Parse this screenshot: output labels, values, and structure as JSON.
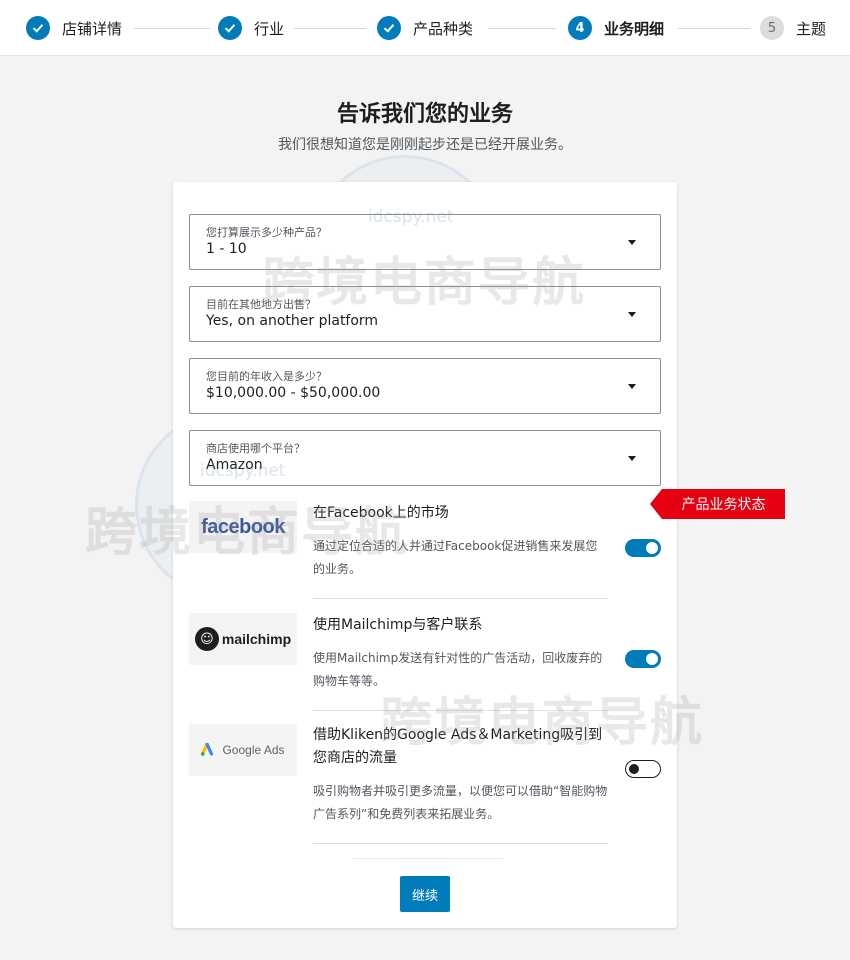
{
  "stepper": {
    "steps": [
      {
        "label": "店铺详情",
        "state": "done",
        "icon": "check-icon"
      },
      {
        "label": "行业",
        "state": "done",
        "icon": "check-icon"
      },
      {
        "label": "产品种类",
        "state": "done",
        "icon": "check-icon"
      },
      {
        "label": "业务明细",
        "state": "active",
        "number": "4"
      },
      {
        "label": "主题",
        "state": "todo",
        "number": "5"
      }
    ]
  },
  "page": {
    "title": "告诉我们您的业务",
    "subtitle": "我们很想知道您是刚刚起步还是已经开展业务。"
  },
  "form": {
    "fields": [
      {
        "label": "您打算展示多少种产品？",
        "value": "1 - 10"
      },
      {
        "label": "目前在其他地方出售？",
        "value": "Yes, on another platform"
      },
      {
        "label": "您目前的年收入是多少？",
        "value": "$10,000.00 - $50,000.00"
      },
      {
        "label": "商店使用哪个平台？",
        "value": "Amazon"
      }
    ],
    "extensions": [
      {
        "logo_text": "facebook",
        "title": "在Facebook上的市场",
        "desc": "通过定位合适的人并通过Facebook促进销售来发展您的业务。",
        "enabled": true
      },
      {
        "logo_text": "mailchimp",
        "title": "使用Mailchimp与客户联系",
        "desc": "使用Mailchimp发送有针对性的广告活动，回收废弃的购物车等等。",
        "enabled": true
      },
      {
        "logo_text": "Google Ads",
        "title": "借助Kliken的Google Ads＆Marketing吸引到您商店的流量",
        "desc": "吸引购物者并吸引更多流量，以便您可以借助“智能购物广告系列”和免费列表来拓展业务。",
        "enabled": false
      }
    ],
    "continue_label": "继续"
  },
  "annotation": {
    "label": "产品业务状态",
    "color": "#e60012"
  },
  "watermark": {
    "text": "跨境电商导航",
    "url": "idcspy.net"
  },
  "colors": {
    "accent": "#007cba"
  }
}
